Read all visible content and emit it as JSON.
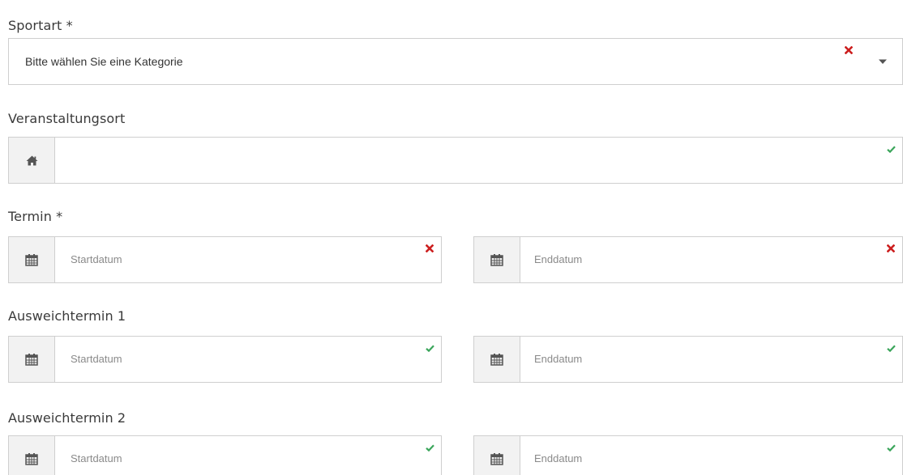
{
  "sport": {
    "label": "Sportart *",
    "select_value": "Bitte wählen Sie eine Kategorie",
    "status": "error"
  },
  "venue": {
    "label": "Veranstaltungsort",
    "value": "",
    "addon_icon": "home-icon",
    "status": "valid"
  },
  "termin": {
    "label": "Termin *",
    "start_placeholder": "Startdatum",
    "end_placeholder": "Enddatum",
    "start_status": "error",
    "end_status": "error"
  },
  "alt1": {
    "label": "Ausweichtermin 1",
    "start_placeholder": "Startdatum",
    "end_placeholder": "Enddatum",
    "start_status": "valid",
    "end_status": "valid"
  },
  "alt2": {
    "label": "Ausweichtermin 2",
    "start_placeholder": "Startdatum",
    "end_placeholder": "Enddatum",
    "start_status": "valid",
    "end_status": "valid"
  },
  "icons": {
    "date_addon": "calendar-icon",
    "error": "cross-icon",
    "valid": "check-icon",
    "dropdown": "caret-down-icon"
  },
  "colors": {
    "error": "#cc1f1f",
    "valid": "#3aa55a",
    "addon_bg": "#f2f2f2",
    "border": "#cfcfcf"
  }
}
